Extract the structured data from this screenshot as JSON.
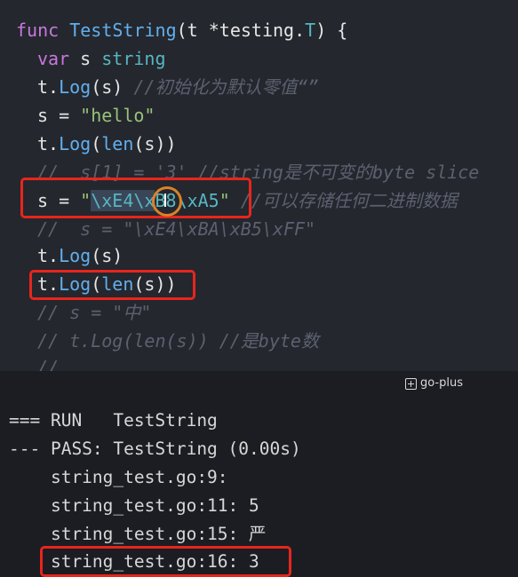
{
  "code": {
    "l1": {
      "kw": "func",
      "name": "TestString",
      "p1": "(t *testing.",
      "type": "T",
      "p2": ") {"
    },
    "l2": {
      "kw": "var",
      "ident": " s ",
      "type": "string"
    },
    "l3": {
      "pre": "t.",
      "fn": "Log",
      "args": "(s) ",
      "comment": "//初始化为默认零值“”"
    },
    "l4": {
      "pre": "s = ",
      "str": "\"hello\""
    },
    "l5": {
      "pre": "t.",
      "fn": "Log",
      "p1": "(",
      "fn2": "len",
      "p2": "(s))"
    },
    "l6": {
      "comment": "//  s[1] = '3' //string是不可变的byte slice"
    },
    "l7": {
      "pre": "s = ",
      "q1": "\"",
      "e1": "\\xE4\\x",
      "e2": "B8",
      "e3": "\\xA5",
      "q2": "\"",
      "comment": " //可以存储任何二进制数据"
    },
    "l8": {
      "comment": "//  s = \"\\xE4\\xBA\\xB5\\xFF\""
    },
    "l9": {
      "pre": "t.",
      "fn": "Log",
      "args": "(s)"
    },
    "l10": {
      "pre": "t.",
      "fn": "Log",
      "p1": "(",
      "fn2": "len",
      "p2": "(s))"
    },
    "l11": {
      "comment": "// s = \"中\""
    },
    "l12": {
      "comment": "// t.Log(len(s)) //是byte数"
    },
    "l13": {
      "comment": "//"
    }
  },
  "panel": {
    "label": "go-plus",
    "icon": "plus-square-icon"
  },
  "output": [
    "=== RUN   TestString",
    "--- PASS: TestString (0.00s)",
    "    string_test.go:9:",
    "    string_test.go:11: 5",
    "    string_test.go:15: 严",
    "    string_test.go:16: 3"
  ],
  "colors": {
    "highlight": "#e8251d",
    "cursor_ring": "#d9822b",
    "keyword": "#c678dd",
    "function": "#61afef",
    "string": "#98c379"
  }
}
